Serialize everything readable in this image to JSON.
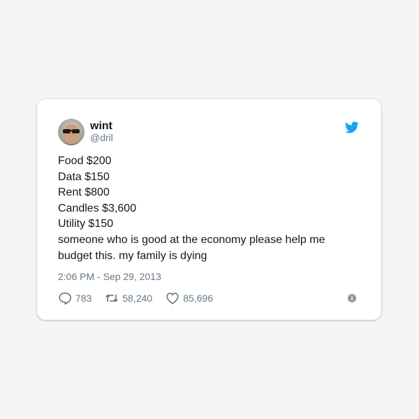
{
  "tweet": {
    "display_name": "wint",
    "handle": "@dril",
    "lines": [
      "Food $200",
      "Data $150",
      "Rent $800",
      "Candles $3,600",
      "Utility $150",
      "someone who is good at the economy please help me",
      "budget this. my family is dying"
    ],
    "timestamp": "2:06 PM - Sep 29, 2013",
    "replies": "783",
    "retweets": "58,240",
    "likes": "85,696"
  },
  "icons": {
    "brand": "twitter-bird-icon",
    "reply": "speech-bubble-icon",
    "retweet": "retweet-arrows-icon",
    "like": "heart-icon",
    "info": "info-icon"
  },
  "colors": {
    "twitter_blue": "#1da1f2",
    "text": "#14171a",
    "muted": "#657786"
  }
}
